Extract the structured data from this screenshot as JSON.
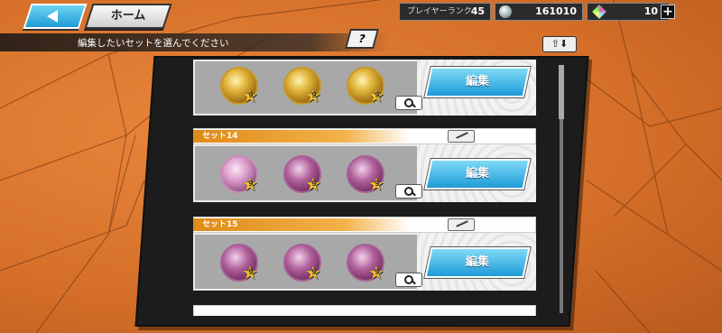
{
  "nav": {
    "home_label": "ホーム"
  },
  "stats": {
    "rank_label": "プレイヤーランク",
    "rank_value": "45",
    "coins_value": "161010",
    "gems_value": "10",
    "plus_label": "+"
  },
  "instruction": "編集したいセットを選んでください",
  "help_label": "?",
  "sort_label": "⇧⬇",
  "sets": [
    {
      "name": "",
      "medal_type": "gold",
      "stars": [
        "9",
        "9",
        "9"
      ],
      "edit_label": "編集"
    },
    {
      "name": "セット14",
      "medal_type": "pink",
      "stars": [
        "9",
        "9",
        "9"
      ],
      "edit_label": "編集"
    },
    {
      "name": "セット15",
      "medal_type": "purple",
      "stars": [
        "9",
        "9",
        "9"
      ],
      "edit_label": "編集"
    }
  ],
  "colors": {
    "accent": "#1e9bd8",
    "tab": "#e08a18",
    "background": "#d9732c"
  }
}
